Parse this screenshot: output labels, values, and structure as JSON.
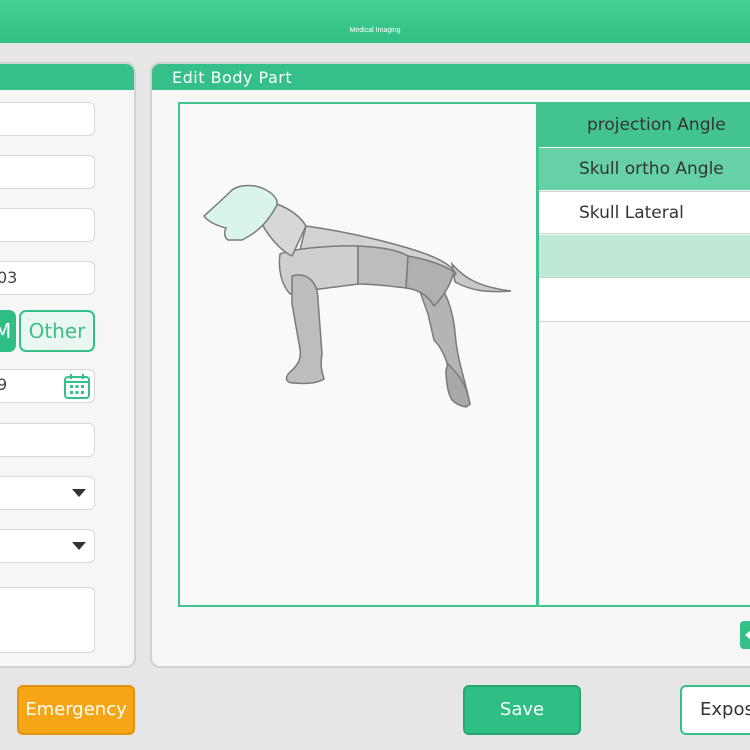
{
  "app": {
    "title": "Medical Imaging"
  },
  "patient_form": {
    "date_fragment": "03",
    "gender_male_fragment": "M",
    "gender_other": "Other",
    "birthdate_fragment": "9"
  },
  "edit_body_part": {
    "title": "Edit Body Part",
    "projection_header": "projection Angle",
    "projections": [
      {
        "label": "Skull ortho Angle",
        "state": "selected"
      },
      {
        "label": "Skull Lateral",
        "state": "normal"
      },
      {
        "label": "",
        "state": "highlight"
      },
      {
        "label": "",
        "state": "normal"
      }
    ]
  },
  "footer": {
    "emergency": "Emergency",
    "save": "Save",
    "expose_fragment": "Expos"
  },
  "colors": {
    "accent": "#34c088",
    "head_highlight": "#d9f5ea",
    "emergency": "#f5a515"
  }
}
